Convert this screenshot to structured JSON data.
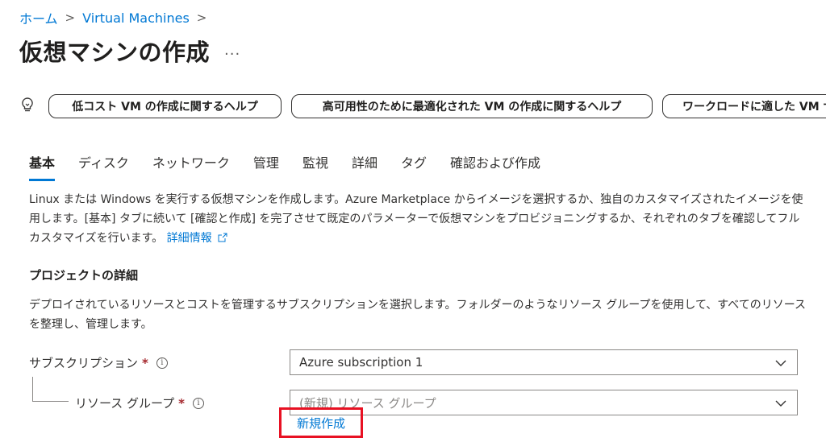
{
  "breadcrumb": {
    "home": "ホーム",
    "section": "Virtual Machines",
    "separator": ">"
  },
  "page": {
    "title": "仮想マシンの作成",
    "more": "..."
  },
  "help_links": [
    "低コスト VM の作成に関するヘルプ",
    "高可用性のために最適化された VM の作成に関するヘルプ",
    "ワークロードに適した VM サ"
  ],
  "tabs": [
    "基本",
    "ディスク",
    "ネットワーク",
    "管理",
    "監視",
    "詳細",
    "タグ",
    "確認および作成"
  ],
  "active_tab": "基本",
  "intro": {
    "text": "Linux または Windows を実行する仮想マシンを作成します。Azure Marketplace からイメージを選択するか、独自のカスタマイズされたイメージを使用します。[基本] タブに続いて [確認と作成] を完了させて既定のパラメーターで仮想マシンをプロビジョニングするか、それぞれのタブを確認してフル カスタマイズを行います。",
    "learn_more": "詳細情報"
  },
  "project_details": {
    "title": "プロジェクトの詳細",
    "description": "デプロイされているリソースとコストを管理するサブスクリプションを選択します。フォルダーのようなリソース グループを使用して、すべてのリソースを整理し、管理します。"
  },
  "form": {
    "subscription": {
      "label": "サブスクリプション",
      "required": "*",
      "value": "Azure subscription 1"
    },
    "resource_group": {
      "label": "リソース グループ",
      "required": "*",
      "placeholder": "(新規) リソース グループ",
      "create_new": "新規作成"
    }
  },
  "colors": {
    "accent": "#0078d4",
    "required": "#a4262c",
    "highlight": "#e81123"
  }
}
